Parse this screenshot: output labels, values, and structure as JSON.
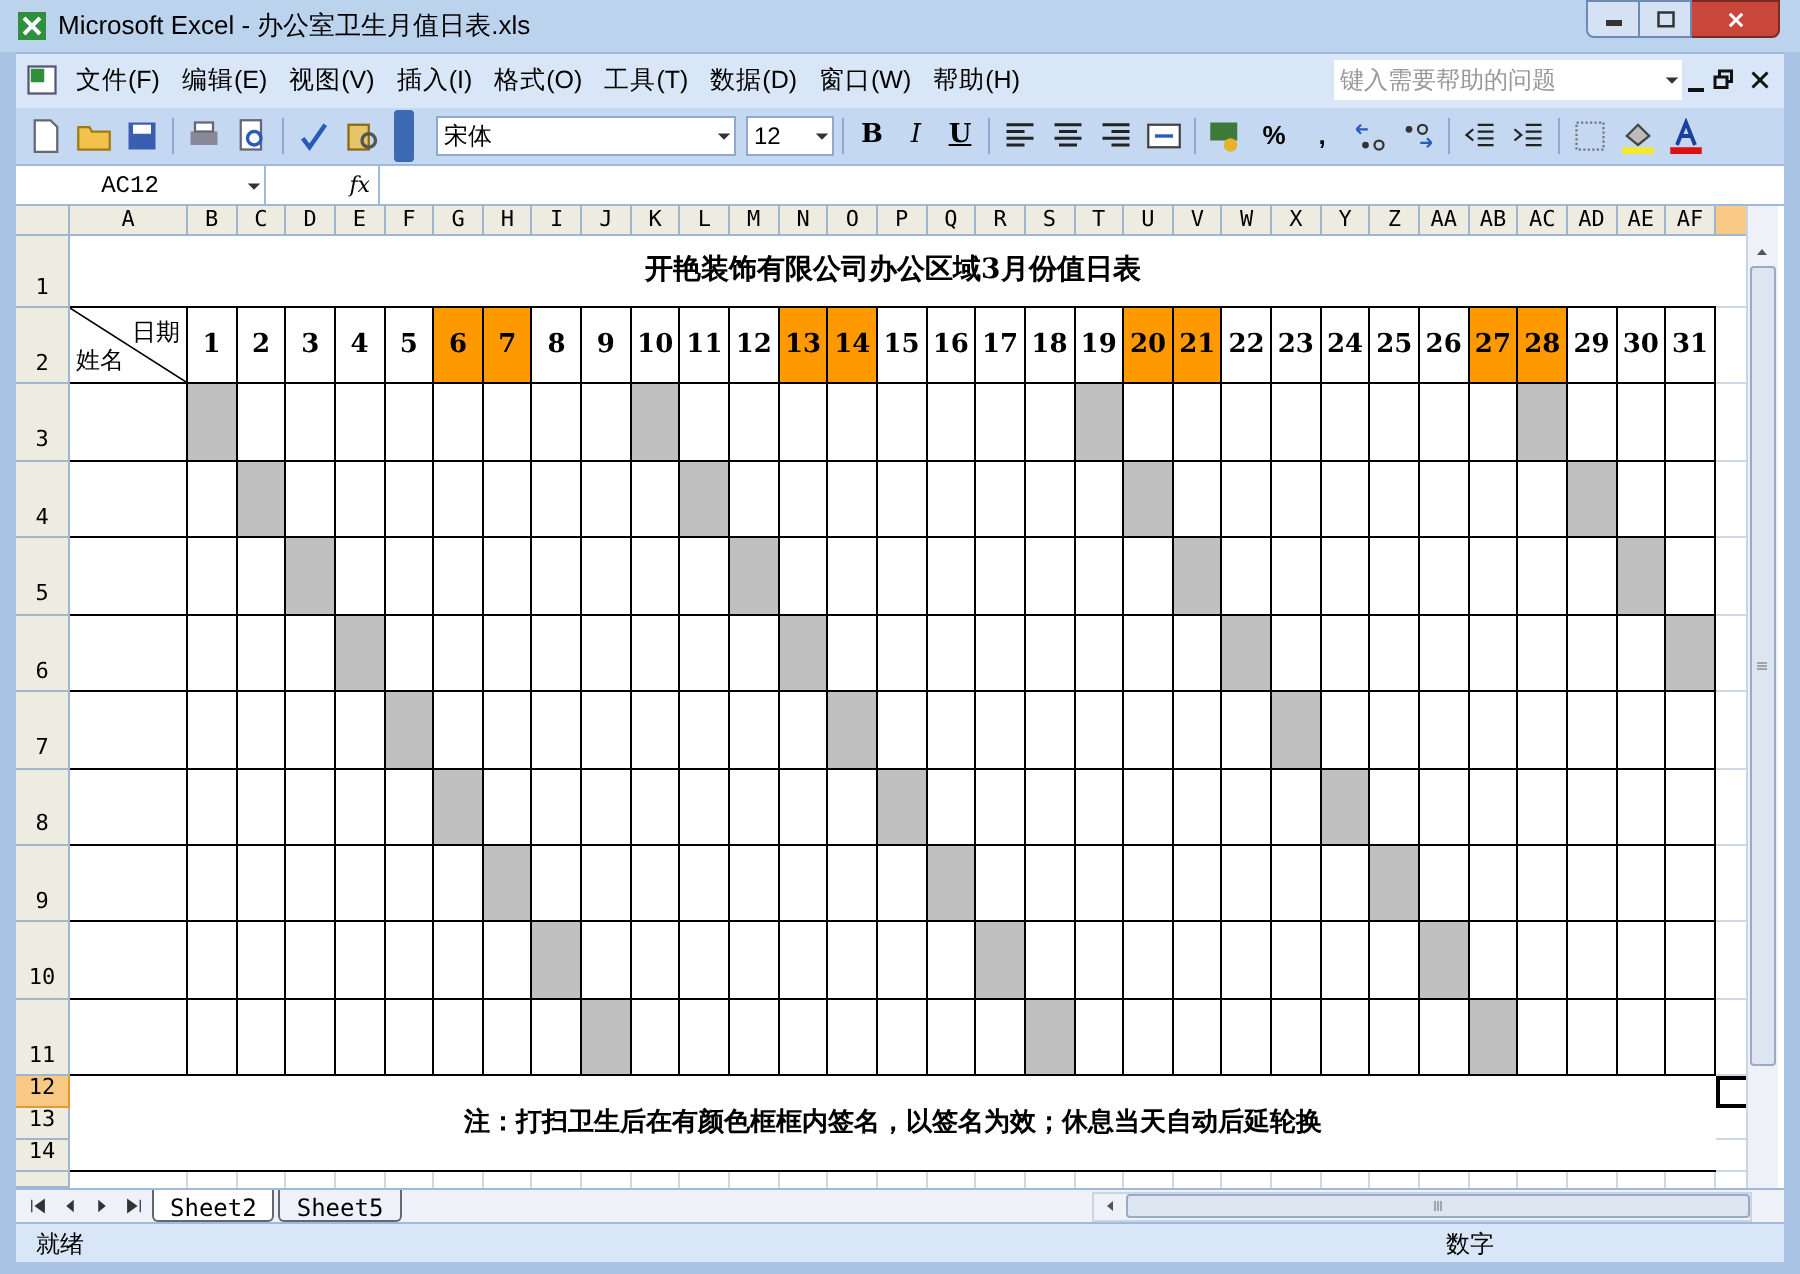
{
  "window": {
    "title": "Microsoft Excel - 办公室卫生月值日表.xls"
  },
  "menu": [
    "文件(F)",
    "编辑(E)",
    "视图(V)",
    "插入(I)",
    "格式(O)",
    "工具(T)",
    "数据(D)",
    "窗口(W)",
    "帮助(H)"
  ],
  "help_box": {
    "placeholder": "键入需要帮助的问题"
  },
  "toolbar": {
    "font": "宋体",
    "size": "12",
    "style_buttons": [
      "B",
      "I",
      "U"
    ],
    "number_buttons": [
      "%",
      ","
    ]
  },
  "formula_bar": {
    "name_box": "AC12",
    "fx": "fx"
  },
  "column_headers": [
    {
      "label": "A",
      "selected": false
    },
    {
      "label": "B",
      "selected": false
    },
    {
      "label": "C",
      "selected": false
    },
    {
      "label": "D",
      "selected": false
    },
    {
      "label": "E",
      "selected": false
    },
    {
      "label": "F",
      "selected": false
    },
    {
      "label": "G",
      "selected": false
    },
    {
      "label": "H",
      "selected": false
    },
    {
      "label": "I",
      "selected": false
    },
    {
      "label": "J",
      "selected": false
    },
    {
      "label": "K",
      "selected": false
    },
    {
      "label": "L",
      "selected": false
    },
    {
      "label": "M",
      "selected": false
    },
    {
      "label": "N",
      "selected": false
    },
    {
      "label": "O",
      "selected": false
    },
    {
      "label": "P",
      "selected": false
    },
    {
      "label": "Q",
      "selected": false
    },
    {
      "label": "R",
      "selected": false
    },
    {
      "label": "S",
      "selected": false
    },
    {
      "label": "T",
      "selected": false
    },
    {
      "label": "U",
      "selected": false
    },
    {
      "label": "V",
      "selected": false
    },
    {
      "label": "W",
      "selected": false
    },
    {
      "label": "X",
      "selected": false
    },
    {
      "label": "Y",
      "selected": false
    },
    {
      "label": "Z",
      "selected": false
    },
    {
      "label": "AA",
      "selected": false
    },
    {
      "label": "AB",
      "selected": false
    },
    {
      "label": "AC",
      "selected": false
    },
    {
      "label": "AD",
      "selected": false
    },
    {
      "label": "AE",
      "selected": false
    },
    {
      "label": "AF",
      "selected": false
    }
  ],
  "extra_column_header": {
    "selected": true
  },
  "sheet_title": "开艳装饰有限公司办公区域3月份值日表",
  "corner_cell": {
    "date_label": "日期",
    "name_label": "姓名"
  },
  "days": [
    {
      "label": "1",
      "weekend": false
    },
    {
      "label": "2",
      "weekend": false
    },
    {
      "label": "3",
      "weekend": false
    },
    {
      "label": "4",
      "weekend": false
    },
    {
      "label": "5",
      "weekend": false
    },
    {
      "label": "6",
      "weekend": true
    },
    {
      "label": "7",
      "weekend": true
    },
    {
      "label": "8",
      "weekend": false
    },
    {
      "label": "9",
      "weekend": false
    },
    {
      "label": "10",
      "weekend": false
    },
    {
      "label": "11",
      "weekend": false
    },
    {
      "label": "12",
      "weekend": false
    },
    {
      "label": "13",
      "weekend": true
    },
    {
      "label": "14",
      "weekend": true
    },
    {
      "label": "15",
      "weekend": false
    },
    {
      "label": "16",
      "weekend": false
    },
    {
      "label": "17",
      "weekend": false
    },
    {
      "label": "18",
      "weekend": false
    },
    {
      "label": "19",
      "weekend": false
    },
    {
      "label": "20",
      "weekend": true
    },
    {
      "label": "21",
      "weekend": true
    },
    {
      "label": "22",
      "weekend": false
    },
    {
      "label": "23",
      "weekend": false
    },
    {
      "label": "24",
      "weekend": false
    },
    {
      "label": "25",
      "weekend": false
    },
    {
      "label": "26",
      "weekend": false
    },
    {
      "label": "27",
      "weekend": true
    },
    {
      "label": "28",
      "weekend": true
    },
    {
      "label": "29",
      "weekend": false
    },
    {
      "label": "30",
      "weekend": false
    },
    {
      "label": "31",
      "weekend": false
    }
  ],
  "row_headers": [
    {
      "label": "1",
      "selected": false
    },
    {
      "label": "2",
      "selected": false
    },
    {
      "label": "3",
      "selected": false
    },
    {
      "label": "4",
      "selected": false
    },
    {
      "label": "5",
      "selected": false
    },
    {
      "label": "6",
      "selected": false
    },
    {
      "label": "7",
      "selected": false
    },
    {
      "label": "8",
      "selected": false
    },
    {
      "label": "9",
      "selected": false
    },
    {
      "label": "10",
      "selected": false
    },
    {
      "label": "11",
      "selected": false
    },
    {
      "label": "12",
      "selected": true
    },
    {
      "label": "13",
      "selected": false
    },
    {
      "label": "14",
      "selected": false
    }
  ],
  "duty_rows": [
    {
      "shaded": [
        true,
        false,
        false,
        false,
        false,
        false,
        false,
        false,
        false,
        true,
        false,
        false,
        false,
        false,
        false,
        false,
        false,
        false,
        true,
        false,
        false,
        false,
        false,
        false,
        false,
        false,
        false,
        true,
        false,
        false,
        false
      ]
    },
    {
      "shaded": [
        false,
        true,
        false,
        false,
        false,
        false,
        false,
        false,
        false,
        false,
        true,
        false,
        false,
        false,
        false,
        false,
        false,
        false,
        false,
        true,
        false,
        false,
        false,
        false,
        false,
        false,
        false,
        false,
        true,
        false,
        false
      ]
    },
    {
      "shaded": [
        false,
        false,
        true,
        false,
        false,
        false,
        false,
        false,
        false,
        false,
        false,
        true,
        false,
        false,
        false,
        false,
        false,
        false,
        false,
        false,
        true,
        false,
        false,
        false,
        false,
        false,
        false,
        false,
        false,
        true,
        false
      ]
    },
    {
      "shaded": [
        false,
        false,
        false,
        true,
        false,
        false,
        false,
        false,
        false,
        false,
        false,
        false,
        true,
        false,
        false,
        false,
        false,
        false,
        false,
        false,
        false,
        true,
        false,
        false,
        false,
        false,
        false,
        false,
        false,
        false,
        true
      ]
    },
    {
      "shaded": [
        false,
        false,
        false,
        false,
        true,
        false,
        false,
        false,
        false,
        false,
        false,
        false,
        false,
        true,
        false,
        false,
        false,
        false,
        false,
        false,
        false,
        false,
        true,
        false,
        false,
        false,
        false,
        false,
        false,
        false,
        false
      ]
    },
    {
      "shaded": [
        false,
        false,
        false,
        false,
        false,
        true,
        false,
        false,
        false,
        false,
        false,
        false,
        false,
        false,
        true,
        false,
        false,
        false,
        false,
        false,
        false,
        false,
        false,
        true,
        false,
        false,
        false,
        false,
        false,
        false,
        false
      ]
    },
    {
      "shaded": [
        false,
        false,
        false,
        false,
        false,
        false,
        true,
        false,
        false,
        false,
        false,
        false,
        false,
        false,
        false,
        true,
        false,
        false,
        false,
        false,
        false,
        false,
        false,
        false,
        true,
        false,
        false,
        false,
        false,
        false,
        false
      ]
    },
    {
      "shaded": [
        false,
        false,
        false,
        false,
        false,
        false,
        false,
        true,
        false,
        false,
        false,
        false,
        false,
        false,
        false,
        false,
        true,
        false,
        false,
        false,
        false,
        false,
        false,
        false,
        false,
        true,
        false,
        false,
        false,
        false,
        false
      ]
    },
    {
      "shaded": [
        false,
        false,
        false,
        false,
        false,
        false,
        false,
        false,
        true,
        false,
        false,
        false,
        false,
        false,
        false,
        false,
        false,
        true,
        false,
        false,
        false,
        false,
        false,
        false,
        false,
        false,
        true,
        false,
        false,
        false,
        false
      ]
    }
  ],
  "note": "注：打扫卫生后在有颜色框框内签名，以签名为效；休息当天自动后延轮换",
  "sheet_tabs": [
    {
      "label": "Sheet2",
      "selected": true
    },
    {
      "label": "Sheet5",
      "selected": false
    }
  ],
  "status_bar": {
    "state": "就绪",
    "mode": "数字"
  }
}
